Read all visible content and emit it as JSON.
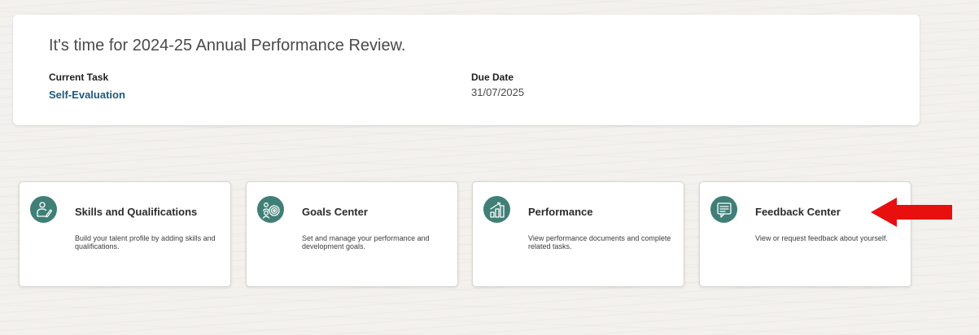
{
  "review": {
    "title": "It's time for 2024-25 Annual Performance Review.",
    "current_task_label": "Current Task",
    "current_task_value": "Self-Evaluation",
    "due_date_label": "Due Date",
    "due_date_value": "31/07/2025"
  },
  "tiles": [
    {
      "title": "Skills and Qualifications",
      "description": "Build your talent profile by adding skills and qualifications.",
      "icon": "person-edit-icon"
    },
    {
      "title": "Goals Center",
      "description": "Set and manage your performance and development goals.",
      "icon": "people-target-icon"
    },
    {
      "title": "Performance",
      "description": "View performance documents and complete related tasks.",
      "icon": "bar-chart-growth-icon"
    },
    {
      "title": "Feedback Center",
      "description": "View or request feedback about yourself.",
      "icon": "feedback-chat-icon"
    }
  ],
  "annotation": {
    "arrow_color": "#e80f0f",
    "points_to": "Feedback Center"
  },
  "colors": {
    "icon_circle": "#3f7f77",
    "link": "#1d5a7c"
  }
}
